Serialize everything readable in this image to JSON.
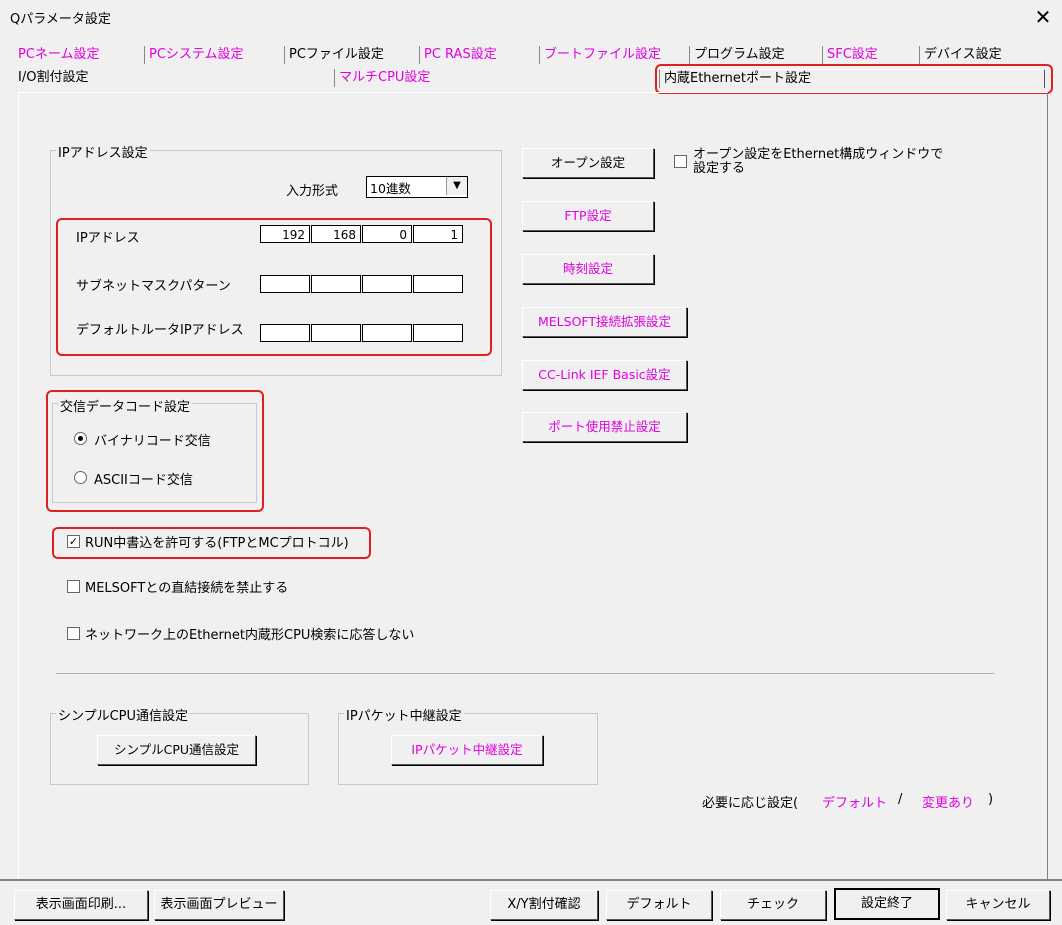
{
  "window": {
    "title": "Qパラメータ設定",
    "close_glyph": "✕"
  },
  "tabs_row1": [
    {
      "label": "PCネーム設定",
      "color": "magenta"
    },
    {
      "label": "PCシステム設定",
      "color": "magenta"
    },
    {
      "label": "PCファイル設定",
      "color": "black"
    },
    {
      "label": "PC RAS設定",
      "color": "magenta"
    },
    {
      "label": "ブートファイル設定",
      "color": "magenta"
    },
    {
      "label": "プログラム設定",
      "color": "black"
    },
    {
      "label": "SFC設定",
      "color": "magenta"
    },
    {
      "label": "デバイス設定",
      "color": "black"
    }
  ],
  "tabs_row2": [
    {
      "label": "I/O割付設定",
      "color": "black"
    },
    {
      "label": "マルチCPU設定",
      "color": "magenta"
    },
    {
      "label": "内蔵Ethernetポート設定",
      "color": "black",
      "active": true
    }
  ],
  "ip_group": {
    "title": "IPアドレス設定",
    "input_format_label": "入力形式",
    "input_format_value": "10進数",
    "ip_label": "IPアドレス",
    "ip_values": [
      "192",
      "168",
      "0",
      "1"
    ],
    "subnet_label": "サブネットマスクパターン",
    "subnet_values": [
      "",
      "",
      "",
      ""
    ],
    "gateway_label": "デフォルトルータIPアドレス",
    "gateway_values": [
      "",
      "",
      "",
      ""
    ]
  },
  "side_buttons": {
    "open": "オープン設定",
    "ftp": "FTP設定",
    "time": "時刻設定",
    "melsoft": "MELSOFT接続拡張設定",
    "cclink": "CC-Link IEF Basic設定",
    "port": "ポート使用禁止設定"
  },
  "open_checkbox": {
    "line1": "オープン設定をEthernet構成ウィンドウで",
    "line2": "設定する",
    "checked": false
  },
  "comm_group": {
    "title": "交信データコード設定",
    "binary": "バイナリコード交信",
    "ascii": "ASCIIコード交信",
    "selected": "binary"
  },
  "checkboxes": [
    {
      "label": "RUN中書込を許可する(FTPとMCプロトコル)",
      "checked": true
    },
    {
      "label": "MELSOFTとの直結接続を禁止する",
      "checked": false
    },
    {
      "label": "ネットワーク上のEthernet内蔵形CPU検索に応答しない",
      "checked": false
    }
  ],
  "simple_cpu": {
    "title": "シンプルCPU通信設定",
    "button": "シンプルCPU通信設定"
  },
  "ip_packet": {
    "title": "IPパケット中継設定",
    "button": "IPパケット中継設定"
  },
  "legend": {
    "prefix": "必要に応じ設定(",
    "default": "デフォルト",
    "slash": "/",
    "changed": "変更あり",
    "suffix": ")"
  },
  "footer": {
    "print": "表示画面印刷...",
    "preview": "表示画面プレビュー",
    "xy": "X/Y割付確認",
    "default": "デフォルト",
    "check": "チェック",
    "finish": "設定終了",
    "cancel": "キャンセル"
  },
  "colors": {
    "accent_magenta": "#e000e0",
    "highlight_red": "#e02020"
  }
}
